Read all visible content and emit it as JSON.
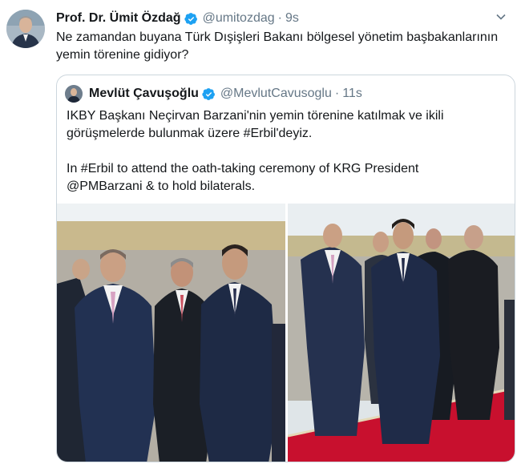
{
  "tweet": {
    "author_name": "Prof. Dr. Ümit Özdağ",
    "handle": "@umitozdag",
    "separator": "·",
    "time": "9s",
    "text_line1": "Ne zamandan buyana Türk Dışişleri Bakanı bölgesel yönetim başbakanlarının",
    "text_line2": "yemin törenine gidiyor?"
  },
  "quoted": {
    "author_name": "Mevlüt Çavuşoğlu",
    "handle": "@MevlutCavusoglu",
    "separator": "·",
    "time": "11s",
    "para1_line1": "IKBY Başkanı Neçirvan Barzani'nin yemin törenine katılmak ve ikili",
    "para1_line2": "görüşmelerde bulunmak üzere #Erbil'deyiz.",
    "para2_line1": "In #Erbil to attend the oath-taking ceremony of KRG President",
    "para2_line2": "@PMBarzani & to hold bilaterals."
  },
  "colors": {
    "verified": "#1da1f2",
    "secondary_text": "#657786",
    "border": "#ccd6dd",
    "carpet": "#c8102e"
  },
  "icons": {
    "verified": "verified-badge-icon",
    "caret": "chevron-down-icon"
  }
}
